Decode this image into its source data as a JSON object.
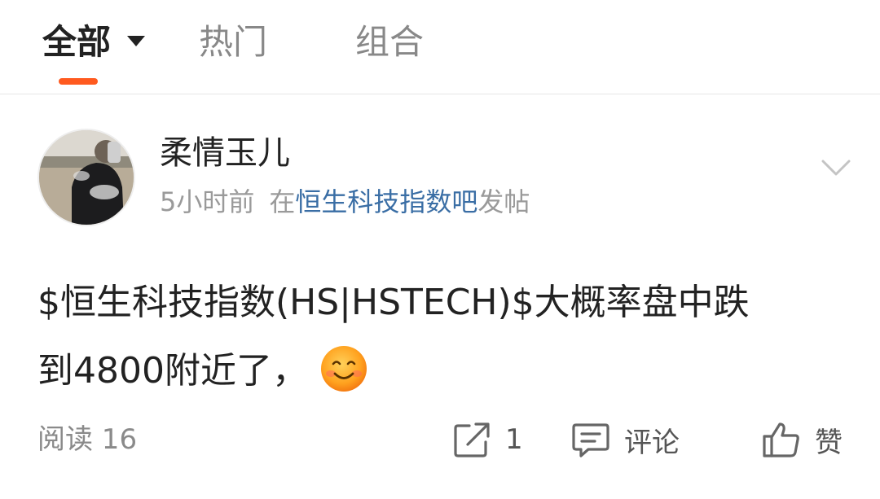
{
  "tabs": {
    "all_label": "全部",
    "hot_label": "热门",
    "combo_label": "组合",
    "accent_color": "#ff5a1f"
  },
  "post": {
    "author": "柔情玉儿",
    "time_ago": "5小时前",
    "in_prefix": "在",
    "forum": "恒生科技指数吧",
    "action_suffix": "发帖",
    "text_line1": "$恒生科技指数(HS|HSTECH)$大概率盘中跌",
    "text_line2": "到4800附近了，",
    "emoji": "smiling-face-icon"
  },
  "actions": {
    "read_label": "阅读 16",
    "share_count": "1",
    "comment_label": "评论",
    "like_label": "赞"
  },
  "colors": {
    "link": "#3a6ea5",
    "muted": "#9a9a9a",
    "text": "#222222"
  }
}
